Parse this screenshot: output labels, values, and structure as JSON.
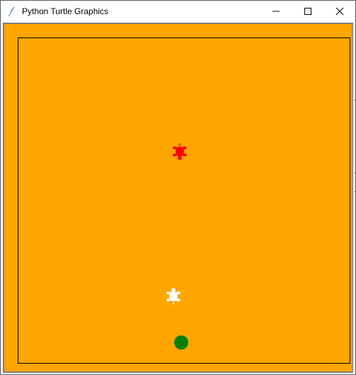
{
  "window": {
    "title": "Python Turtle Graphics",
    "app_icon": "feather-pen-icon",
    "controls": [
      "minimize-icon",
      "maximize-icon",
      "close-icon"
    ]
  },
  "colors": {
    "background": "#ffa500",
    "border_line": "#000000",
    "red_turtle": "#ff0000",
    "white_turtle": "#ffffff",
    "green_ball": "#008000",
    "frame": "#7f7f7f"
  },
  "canvas": {
    "elements": [
      {
        "name": "red-turtle",
        "shape": "turtle",
        "color": "#ff0000",
        "heading": "down"
      },
      {
        "name": "white-turtle",
        "shape": "turtle",
        "color": "#ffffff",
        "heading": "up"
      },
      {
        "name": "green-ball",
        "shape": "circle",
        "color": "#008000"
      }
    ]
  }
}
